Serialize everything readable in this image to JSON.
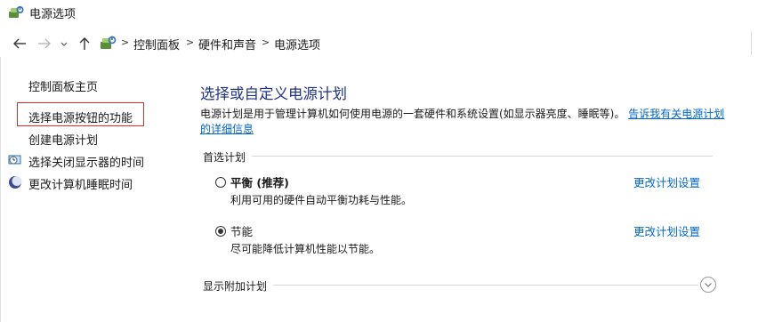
{
  "window": {
    "title": "电源选项",
    "icon": "power-options-icon"
  },
  "nav": {
    "back": "back-arrow-icon",
    "forward": "forward-arrow-icon",
    "recent": "recent-locations-chevron-icon",
    "up": "up-arrow-icon",
    "breadcrumbs": [
      "控制面板",
      "硬件和声音",
      "电源选项"
    ],
    "separator": ">"
  },
  "sidebar": {
    "items": [
      {
        "label": "控制面板主页",
        "icon": null
      },
      {
        "label": "选择电源按钮的功能",
        "icon": null
      },
      {
        "label": "创建电源计划",
        "icon": null
      },
      {
        "label": "选择关闭显示器的时间",
        "icon": "monitor-clock-icon"
      },
      {
        "label": "更改计算机睡眠时间",
        "icon": "moon-sleep-icon"
      }
    ]
  },
  "main": {
    "title": "选择或自定义电源计划",
    "description": "电源计划是用于管理计算机如何使用电源的一套硬件和系统设置(如显示器亮度、睡眠等)。",
    "description_link": "告诉我有关电源计划的详细信息",
    "preferred_label": "首选计划",
    "plans": [
      {
        "name": "平衡 (推荐)",
        "desc": "利用可用的硬件自动平衡功耗与性能。",
        "link": "更改计划设置",
        "selected": false
      },
      {
        "name": "节能",
        "desc": "尽可能降低计算机性能以节能。",
        "link": "更改计划设置",
        "selected": true
      }
    ],
    "more_plans_label": "显示附加计划"
  },
  "colors": {
    "title": "#1e3287",
    "link": "#0066cc",
    "highlight_box": "#e0292b"
  }
}
